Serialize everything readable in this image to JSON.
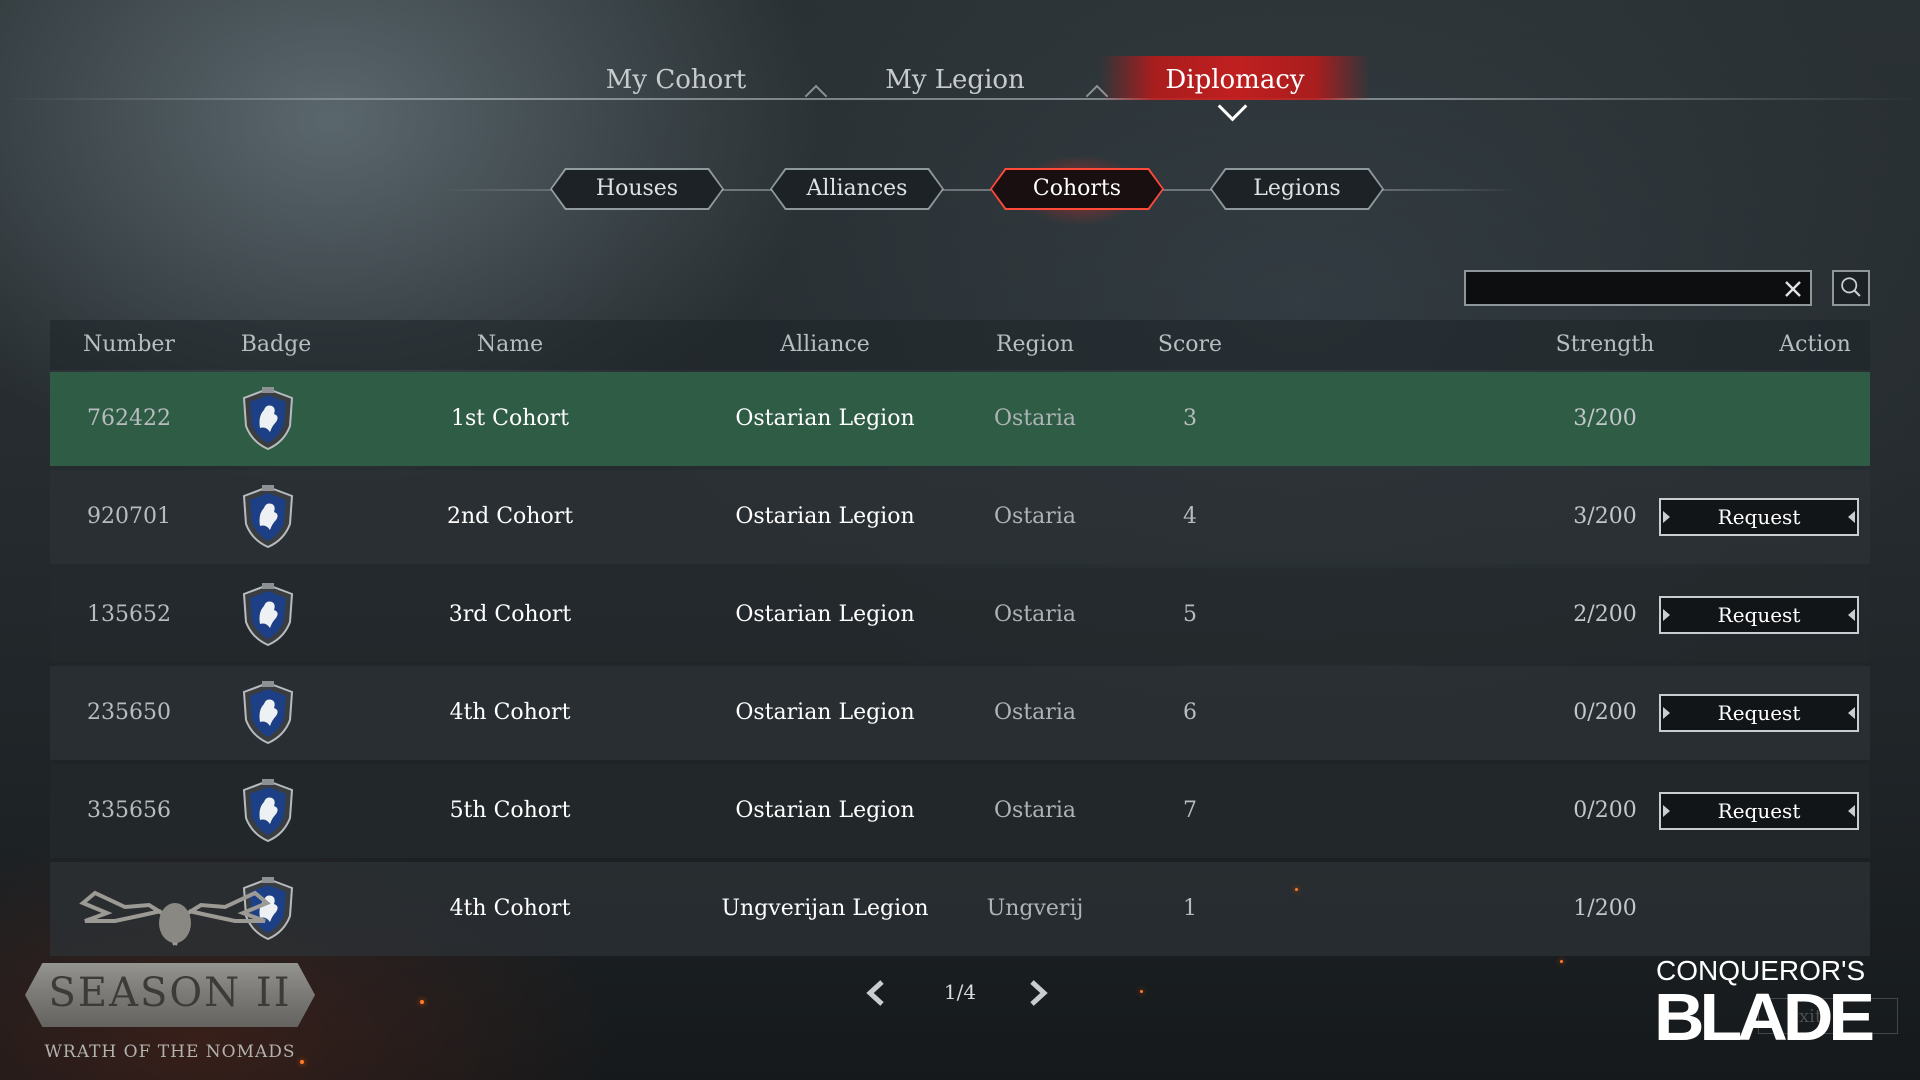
{
  "top_tabs": [
    {
      "label": "My Cohort",
      "active": false
    },
    {
      "label": "My Legion",
      "active": false
    },
    {
      "label": "Diplomacy",
      "active": true
    }
  ],
  "sub_tabs": [
    {
      "label": "Houses",
      "active": false
    },
    {
      "label": "Alliances",
      "active": false
    },
    {
      "label": "Cohorts",
      "active": true
    },
    {
      "label": "Legions",
      "active": false
    }
  ],
  "search": {
    "value": "",
    "clear_icon": "close-icon",
    "search_icon": "magnifier-icon"
  },
  "table": {
    "headers": {
      "number": "Number",
      "badge": "Badge",
      "name": "Name",
      "alliance": "Alliance",
      "region": "Region",
      "score": "Score",
      "strength": "Strength",
      "action": "Action"
    },
    "rows": [
      {
        "number": "762422",
        "badge": "wolf-shield",
        "name": "1st Cohort",
        "alliance": "Ostarian Legion",
        "region": "Ostaria",
        "score": "3",
        "strength": "3/200",
        "action": "",
        "highlight": true
      },
      {
        "number": "920701",
        "badge": "wolf-shield",
        "name": "2nd Cohort",
        "alliance": "Ostarian Legion",
        "region": "Ostaria",
        "score": "4",
        "strength": "3/200",
        "action": "Request"
      },
      {
        "number": "135652",
        "badge": "wolf-shield",
        "name": "3rd Cohort",
        "alliance": "Ostarian Legion",
        "region": "Ostaria",
        "score": "5",
        "strength": "2/200",
        "action": "Request"
      },
      {
        "number": "235650",
        "badge": "wolf-shield",
        "name": "4th Cohort",
        "alliance": "Ostarian Legion",
        "region": "Ostaria",
        "score": "6",
        "strength": "0/200",
        "action": "Request"
      },
      {
        "number": "335656",
        "badge": "wolf-shield",
        "name": "5th Cohort",
        "alliance": "Ostarian Legion",
        "region": "Ostaria",
        "score": "7",
        "strength": "0/200",
        "action": "Request"
      },
      {
        "number": "",
        "badge": "wolf-shield",
        "name": "4th Cohort",
        "alliance": "Ungverijan Legion",
        "region": "Ungverij",
        "score": "1",
        "strength": "1/200",
        "action": ""
      }
    ]
  },
  "pagination": {
    "text": "1/4"
  },
  "season_logo": {
    "title": "SEASON II",
    "subtitle": "WRATH OF THE NOMADS"
  },
  "game_logo": {
    "line1": "CONQUEROR'S",
    "line2": "BLADE"
  },
  "footer": {
    "exit_label": "xit"
  },
  "colors": {
    "accent_red": "#c81e1e",
    "highlight_row": "#2f5c45",
    "badge_blue": "#1c3f86"
  }
}
